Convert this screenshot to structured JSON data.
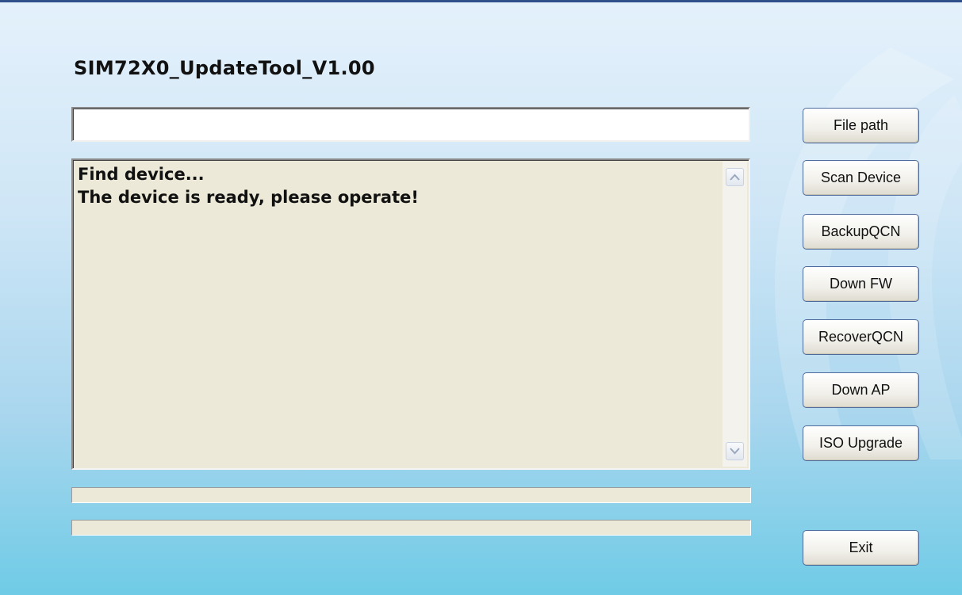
{
  "app": {
    "title": "SIM72X0_UpdateTool_V1.00"
  },
  "file_path": {
    "value": ""
  },
  "log": {
    "lines": [
      "Find device...",
      "The device is ready, please operate!"
    ]
  },
  "progress": [
    {
      "value": 0
    },
    {
      "value": 0
    }
  ],
  "buttons": {
    "file_path": "File path",
    "scan_device": "Scan Device",
    "backup_qcn": "BackupQCN",
    "down_fw": "Down FW",
    "recover_qcn": "RecoverQCN",
    "down_ap": "Down AP",
    "iso_upgrade": "ISO Upgrade",
    "exit": "Exit"
  },
  "colors": {
    "background_top": "#e4f1fb",
    "background_bottom": "#6fcbe6",
    "log_background": "#ece9d8",
    "title_bar": "#2f4f8a"
  },
  "icons": {
    "scroll_up": "chevron-up-icon",
    "scroll_down": "chevron-down-icon"
  }
}
